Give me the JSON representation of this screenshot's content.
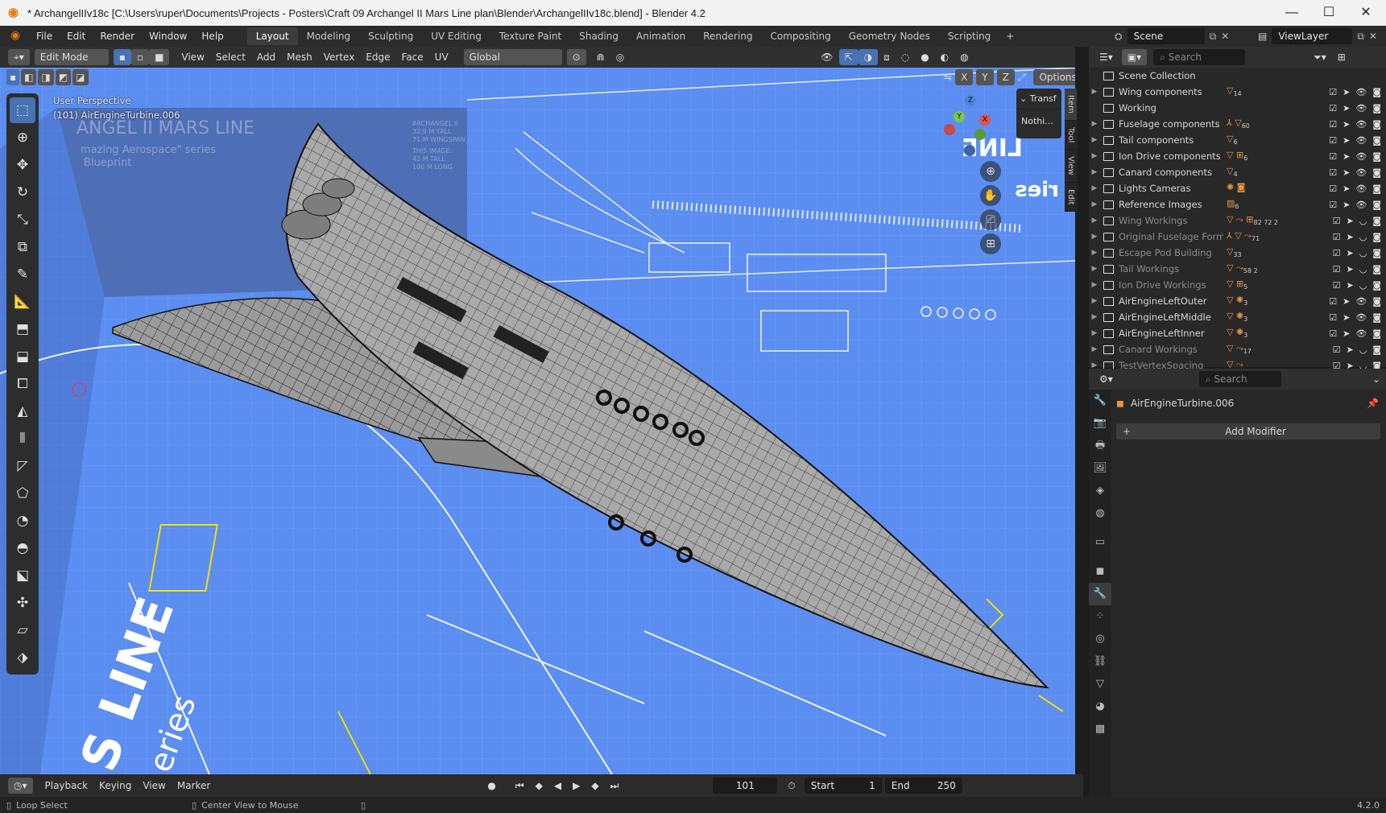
{
  "window": {
    "title": "* ArchangelIIv18c [C:\\Users\\ruper\\Documents\\Projects - Posters\\Craft 09 Archangel II Mars Line plan\\Blender\\ArchangelIIv18c.blend] - Blender 4.2",
    "minimize": "—",
    "maximize": "☐",
    "close": "✕"
  },
  "menu": [
    "File",
    "Edit",
    "Render",
    "Window",
    "Help"
  ],
  "workspaces": [
    "Layout",
    "Modeling",
    "Sculpting",
    "UV Editing",
    "Texture Paint",
    "Shading",
    "Animation",
    "Rendering",
    "Compositing",
    "Geometry Nodes",
    "Scripting"
  ],
  "active_workspace": "Layout",
  "scene": {
    "label": "Scene",
    "view_layer": "ViewLayer"
  },
  "header": {
    "mode": "Edit Mode",
    "menus": [
      "View",
      "Select",
      "Add",
      "Mesh",
      "Vertex",
      "Edge",
      "Face",
      "UV"
    ],
    "orientation": "Global",
    "options": "Options"
  },
  "viewport": {
    "perspective": "User Perspective",
    "object": "(101) AirEngineTurbine.006",
    "npanel_transform": "Transf",
    "npanel_nothing": "Nothi...",
    "ntabs": [
      "Item",
      "Tool",
      "View",
      "Edit"
    ],
    "axes": [
      "X",
      "Y",
      "Z"
    ],
    "bg_texts": {
      "poster_title": "ANGEL II MARS LINE",
      "poster_sub1": "mazing Aerospace\" series",
      "poster_sub2": "Blueprint",
      "poster_stat1": "ARCHANGEL II",
      "poster_stat2": "32.9 M TALL",
      "poster_stat3": "71 M WINGSPAN",
      "poster_stat4": "THIS IMAGE:",
      "poster_stat5": "42 M TALL",
      "poster_stat6": "100 M LONG",
      "floor_big": "S LINE",
      "floor_small": "eries",
      "wall_big": "LINE",
      "wall_small": "ries"
    },
    "colors": {
      "background": "#5b8ef0",
      "mesh": "#a9a9a9",
      "lines": "#ffffff",
      "accent_yellow": "#f2e000"
    }
  },
  "outliner": {
    "search_placeholder": "Search",
    "root": "Scene Collection",
    "rows": [
      {
        "label": "Wing components",
        "badge": "▽",
        "count": "14",
        "dim": false,
        "expandable": true
      },
      {
        "label": "Working",
        "badge": "",
        "count": "",
        "dim": false,
        "expandable": false
      },
      {
        "label": "Fuselage components",
        "badge": "⅄ ▽",
        "count": "60",
        "dim": false,
        "expandable": true
      },
      {
        "label": "Tail components",
        "badge": "▽",
        "count": "6",
        "dim": false,
        "expandable": true
      },
      {
        "label": "Ion Drive components",
        "badge": "▽ ⊞",
        "count": "6",
        "dim": false,
        "expandable": true
      },
      {
        "label": "Canard components",
        "badge": "▽",
        "count": "4",
        "dim": false,
        "expandable": true
      },
      {
        "label": "Lights Cameras",
        "badge": "✺ ◙",
        "count": "",
        "dim": false,
        "expandable": true
      },
      {
        "label": "Reference Images",
        "badge": "▨",
        "count": "6",
        "dim": false,
        "expandable": true
      },
      {
        "label": "Wing Workings",
        "badge": "▽ ⤳ ⊞",
        "count": "82 72 2",
        "dim": true,
        "expandable": true
      },
      {
        "label": "Original Fuselage Forms",
        "badge": "⅄ ▽ ⤳",
        "count": "71",
        "dim": true,
        "expandable": true
      },
      {
        "label": "Escape Pod Building",
        "badge": "▽",
        "count": "33",
        "dim": true,
        "expandable": true
      },
      {
        "label": "Tail Workings",
        "badge": "▽ ⤳",
        "count": "58 2",
        "dim": true,
        "expandable": true
      },
      {
        "label": "Ion Drive Workings",
        "badge": "▽ ⊞",
        "count": "5",
        "dim": true,
        "expandable": true
      },
      {
        "label": "AirEngineLeftOuter",
        "badge": "▽ ✺",
        "count": "3",
        "dim": false,
        "expandable": true
      },
      {
        "label": "AirEngineLeftMiddle",
        "badge": "▽ ✺",
        "count": "3",
        "dim": false,
        "expandable": true
      },
      {
        "label": "AirEngineLeftInner",
        "badge": "▽ ✺",
        "count": "3",
        "dim": false,
        "expandable": true
      },
      {
        "label": "Canard Workings",
        "badge": "▽ ⤳",
        "count": "17",
        "dim": true,
        "expandable": true
      },
      {
        "label": "TestVertexSpacing",
        "badge": "▽ ⤳",
        "count": "",
        "dim": true,
        "expandable": true
      }
    ]
  },
  "properties": {
    "search_placeholder": "Search",
    "object_name": "AirEngineTurbine.006",
    "add_modifier": "Add Modifier"
  },
  "timeline": {
    "menus": [
      "Playback",
      "Keying",
      "View",
      "Marker"
    ],
    "frame": "101",
    "start_label": "Start",
    "start": "1",
    "end_label": "End",
    "end": "250"
  },
  "status": {
    "left": "Loop Select",
    "middle": "Center View to Mouse",
    "version": "4.2.0"
  }
}
